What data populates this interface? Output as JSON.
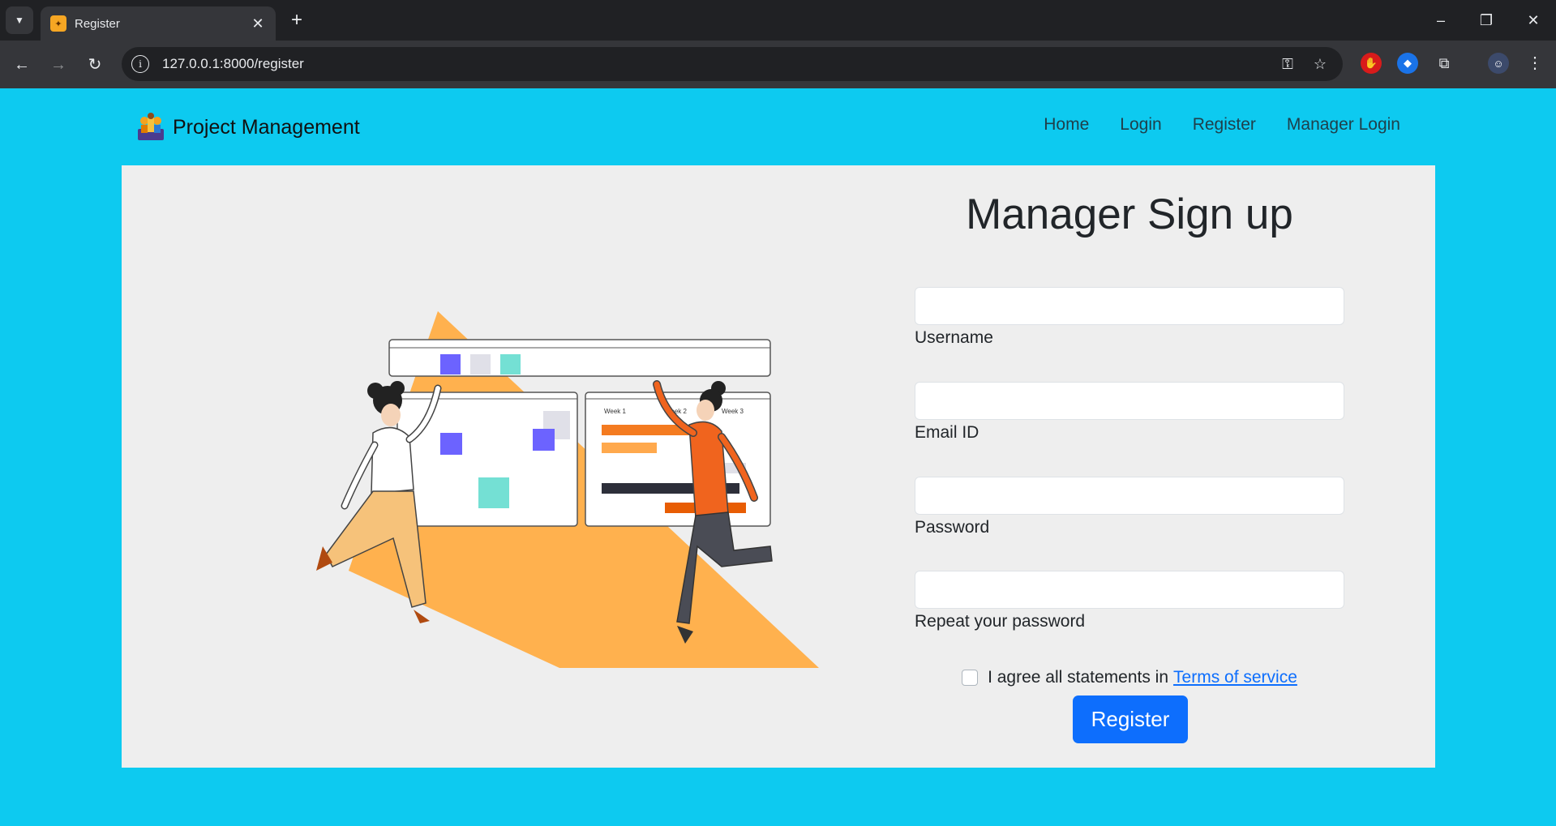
{
  "browser": {
    "tab_title": "Register",
    "url": "127.0.0.1:8000/register"
  },
  "nav": {
    "brand": "Project Management",
    "links": [
      "Home",
      "Login",
      "Register",
      "Manager Login"
    ]
  },
  "form": {
    "title": "Manager Sign up",
    "fields": [
      {
        "label": "Username",
        "value": ""
      },
      {
        "label": "Email ID",
        "value": ""
      },
      {
        "label": "Password",
        "value": ""
      },
      {
        "label": "Repeat your password",
        "value": ""
      }
    ],
    "terms_text": "I agree all statements in",
    "terms_link": "Terms of service",
    "submit": "Register"
  },
  "illustration": {
    "week_labels": [
      "Week 1",
      "Week 2",
      "Week 3"
    ]
  },
  "colors": {
    "page_bg": "#0dcaf0",
    "card_bg": "#eeeeee",
    "primary": "#0d6efd",
    "accent_orange": "#ffb14e"
  },
  "icons": [
    "tab-list-icon",
    "close-icon",
    "plus-icon",
    "minimize-icon",
    "restore-icon",
    "back-icon",
    "forward-icon",
    "reload-icon",
    "info-icon",
    "key-icon",
    "star-icon",
    "extensions-icon",
    "profile-avatar"
  ]
}
